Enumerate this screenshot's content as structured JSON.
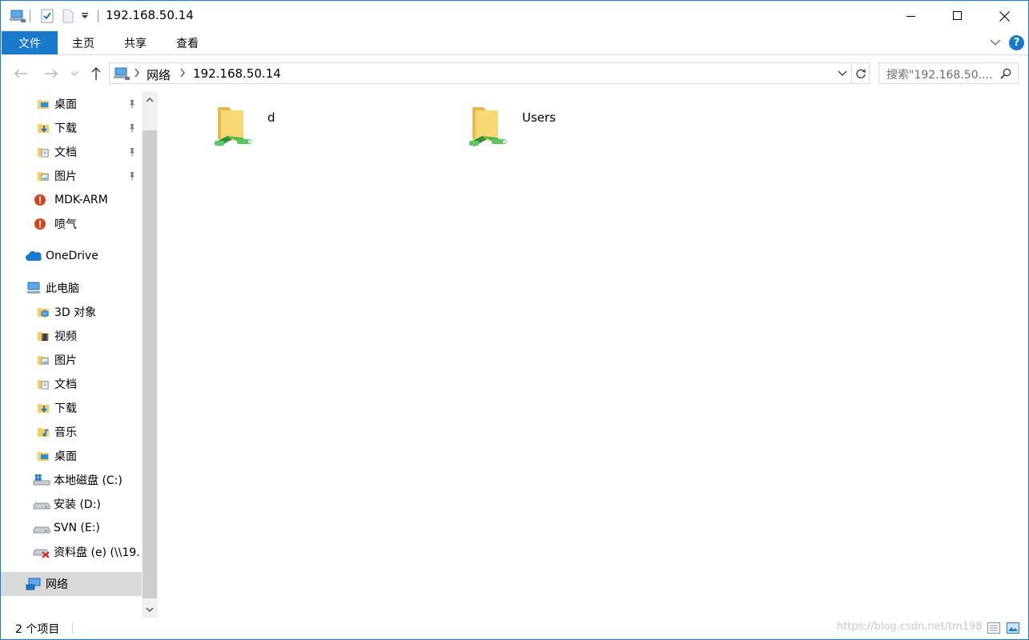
{
  "window": {
    "title": "192.168.50.14",
    "accent_color": "#1979ca"
  },
  "ribbon": {
    "tabs": [
      {
        "label": "文件"
      },
      {
        "label": "主页"
      },
      {
        "label": "共享"
      },
      {
        "label": "查看"
      }
    ],
    "help_label": "?"
  },
  "navigation": {
    "address_segments": [
      "网络",
      "192.168.50.14"
    ],
    "search_placeholder": "搜索\"192.168.50...."
  },
  "sidebar": {
    "items": [
      {
        "label": "桌面",
        "icon": "desktop-folder-icon",
        "pinned": true
      },
      {
        "label": "下载",
        "icon": "downloads-folder-icon",
        "pinned": true
      },
      {
        "label": "文档",
        "icon": "documents-folder-icon",
        "pinned": true
      },
      {
        "label": "图片",
        "icon": "pictures-folder-icon",
        "pinned": true
      },
      {
        "label": "MDK-ARM",
        "icon": "warning-folder-icon",
        "pinned": false
      },
      {
        "label": "喷气",
        "icon": "warning-folder-icon",
        "pinned": false
      },
      {
        "label": "OneDrive",
        "icon": "onedrive-icon",
        "pinned": false
      },
      {
        "label": "此电脑",
        "icon": "computer-icon",
        "pinned": false
      },
      {
        "label": "3D 对象",
        "icon": "3d-objects-folder-icon",
        "pinned": false
      },
      {
        "label": "视频",
        "icon": "videos-folder-icon",
        "pinned": false
      },
      {
        "label": "图片",
        "icon": "pictures-folder-icon",
        "pinned": false
      },
      {
        "label": "文档",
        "icon": "documents-folder-icon",
        "pinned": false
      },
      {
        "label": "下载",
        "icon": "downloads-folder-icon",
        "pinned": false
      },
      {
        "label": "音乐",
        "icon": "music-folder-icon",
        "pinned": false
      },
      {
        "label": "桌面",
        "icon": "desktop-folder-icon",
        "pinned": false
      },
      {
        "label": "本地磁盘 (C:)",
        "icon": "windows-drive-icon",
        "pinned": false
      },
      {
        "label": "安装 (D:)",
        "icon": "drive-icon",
        "pinned": false
      },
      {
        "label": "SVN (E:)",
        "icon": "drive-icon",
        "pinned": false
      },
      {
        "label": "资料盘 (e) (\\\\19.",
        "icon": "disconnected-network-drive-icon",
        "pinned": false
      },
      {
        "label": "网络",
        "icon": "network-icon",
        "pinned": false,
        "selected": true
      }
    ]
  },
  "content": {
    "items": [
      {
        "name": "d",
        "icon": "shared-folder-icon"
      },
      {
        "name": "Users",
        "icon": "shared-folder-icon"
      }
    ]
  },
  "status": {
    "item_count": "2 个项目",
    "watermark": "https://blog.csdn.net/tm198"
  }
}
